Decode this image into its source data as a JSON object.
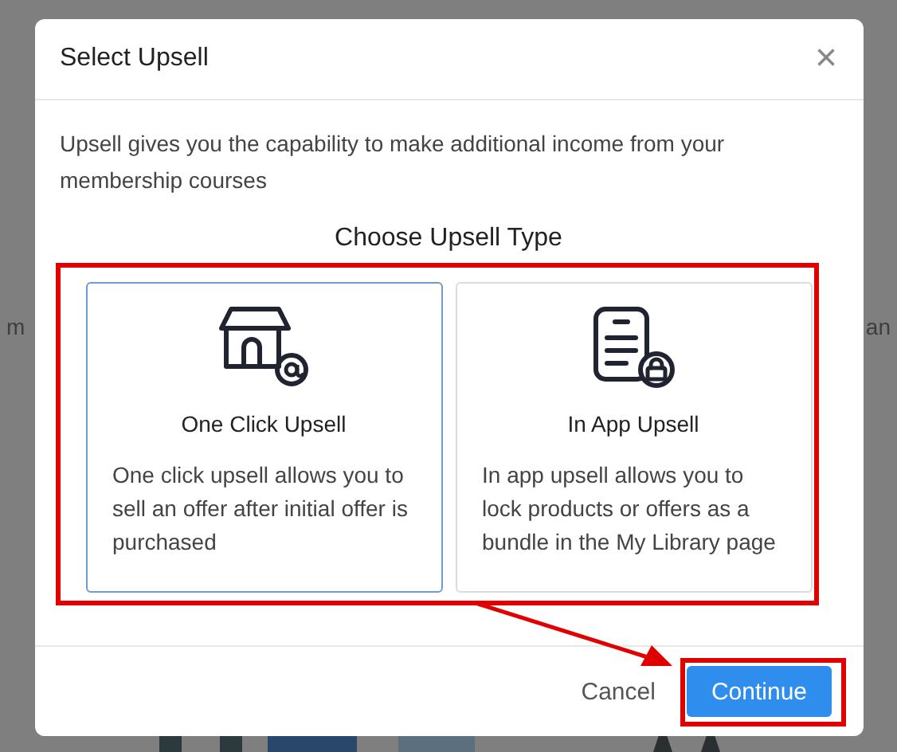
{
  "background_text": [
    "m",
    "an"
  ],
  "dialog": {
    "title": "Select Upsell",
    "close": "×",
    "description": "Upsell gives you the capability to make additional income from your membership courses",
    "section_title": "Choose Upsell Type",
    "options": [
      {
        "kind": "store",
        "title": "One Click Upsell",
        "description": "One click upsell allows you to sell an offer after initial offer is purchased",
        "selected": true
      },
      {
        "kind": "document",
        "title": "In App Upsell",
        "description": "In app upsell allows you to lock products or offers as a bundle in the My Library page",
        "selected": false
      }
    ],
    "buttons": [
      {
        "label": "Cancel",
        "kind": "secondary"
      },
      {
        "label": "Continue",
        "kind": "primary"
      }
    ]
  }
}
